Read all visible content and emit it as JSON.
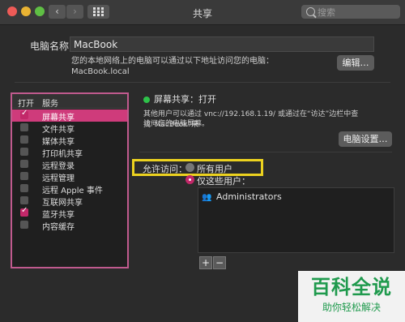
{
  "window": {
    "title": "共享",
    "nav_back": "‹",
    "nav_forward": "›"
  },
  "search": {
    "placeholder": "搜索"
  },
  "computer_name": {
    "label": "电脑名称：",
    "value": "MacBook",
    "hint_line1": "您的本地网络上的电脑可以通过以下地址访问您的电脑：",
    "hint_line2": "MacBook.local",
    "edit_button": "编辑…"
  },
  "services": {
    "header_on": "打开",
    "header_service": "服务",
    "items": [
      {
        "label": "屏幕共享",
        "checked": true,
        "selected": true
      },
      {
        "label": "文件共享",
        "checked": false,
        "selected": false
      },
      {
        "label": "媒体共享",
        "checked": false,
        "selected": false
      },
      {
        "label": "打印机共享",
        "checked": false,
        "selected": false
      },
      {
        "label": "远程登录",
        "checked": false,
        "selected": false
      },
      {
        "label": "远程管理",
        "checked": false,
        "selected": false
      },
      {
        "label": "远程 Apple 事件",
        "checked": false,
        "selected": false
      },
      {
        "label": "互联网共享",
        "checked": false,
        "selected": false
      },
      {
        "label": "蓝牙共享",
        "checked": true,
        "selected": false
      },
      {
        "label": "内容缓存",
        "checked": false,
        "selected": false
      }
    ]
  },
  "screen_sharing": {
    "status": "屏幕共享：打开",
    "status_color": "#2ec24a",
    "desc_line1": "其他用户可以通过 vnc://192.168.1.19/ 或通过在“访达”边栏中查找“MacBook”来",
    "desc_line2": "访问您的电脑屏幕。",
    "settings_button": "电脑设置…"
  },
  "access": {
    "label": "允许访问：",
    "option_all": "所有用户",
    "option_only": "仅这些用户：",
    "selected": "仅这些用户：",
    "users": [
      "Administrators"
    ],
    "add_button": "+",
    "remove_button": "−"
  },
  "watermark": {
    "title": "百科全说",
    "subtitle": "助你轻松解决"
  }
}
